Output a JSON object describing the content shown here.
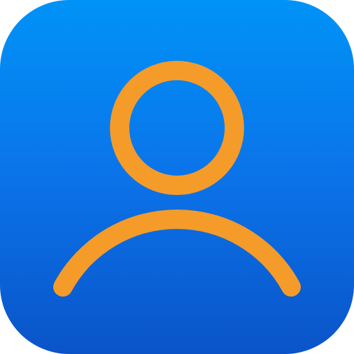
{
  "app_icon": {
    "icon": "user-icon",
    "colors": {
      "background_top": "#0093f7",
      "background_middle": "#0b73e9",
      "background_bottom": "#0a54c8",
      "glyph": "#f59b2a"
    }
  }
}
